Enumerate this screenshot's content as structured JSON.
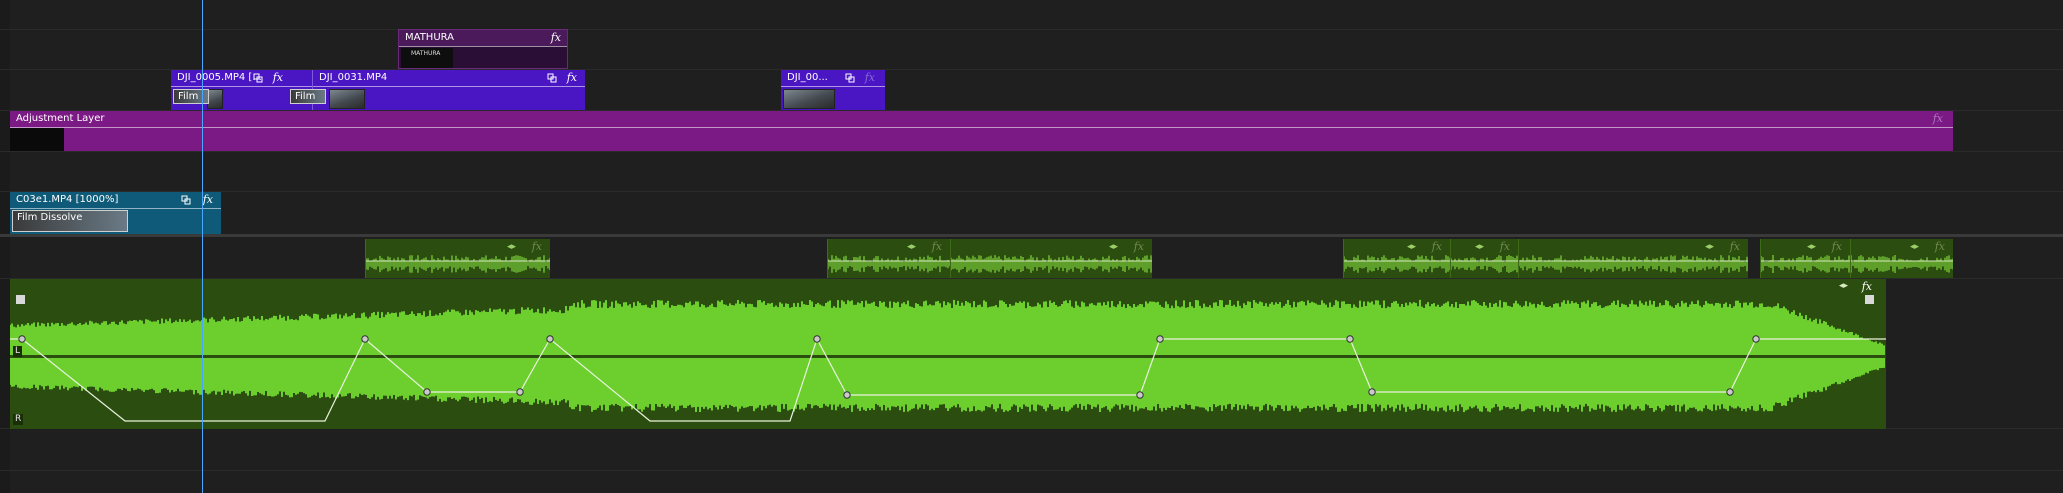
{
  "colors": {
    "background": "#1f1f1f",
    "video_clip": "#4a16c4",
    "adjustment_layer": "#7b1a84",
    "title_clip": "#3a1048",
    "teal_clip": "#0f5a78",
    "audio_clip": "#2c4d10",
    "waveform": "#6ccf2e",
    "playhead": "#4aa6ff"
  },
  "icons": {
    "fx": "fx-badge-icon",
    "link": "linked-clip-icon",
    "keyframe": "audio-keyframe-icon",
    "corner": "clip-corner-icon"
  },
  "clips": {
    "mathura": {
      "name": "MATHURA",
      "thumb_text": "MATHURA",
      "fx": "fx"
    },
    "dji_0005": {
      "name": "DJI_0005.MP4 [...",
      "fx": "fx",
      "transition": "Film"
    },
    "dji_0031": {
      "name": "DJI_0031.MP4",
      "fx": "fx",
      "transition": "Film"
    },
    "dji_00": {
      "name": "DJI_00...",
      "fx": "fx"
    },
    "adjustment": {
      "name": "Adjustment Layer",
      "fx": "fx"
    },
    "c03e1": {
      "name": "C03e1.MP4 [1000%]",
      "fx": "fx",
      "transition": "Film Dissolve"
    }
  },
  "audio": {
    "fx": "fx",
    "channel_left": "L",
    "channel_right": "R"
  }
}
